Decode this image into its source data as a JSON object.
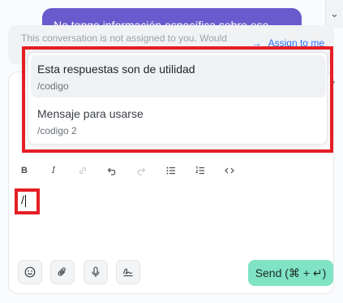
{
  "conversation": {
    "message_text": "No tengo información específica sobre ese",
    "notice_text": "This conversation is not assigned to you. Would",
    "assign_label": "Assign to me",
    "assign_arrow": "→"
  },
  "suggestions": [
    {
      "title": "Esta respuestas son de utilidad",
      "code": "/codigo",
      "active": true
    },
    {
      "title": "Mensaje para usarse",
      "code": "/codigo 2",
      "active": false
    }
  ],
  "toolbar": {
    "bold": "B",
    "italic": "I",
    "icons": [
      "bold-icon",
      "italic-icon",
      "link-icon",
      "undo-icon",
      "redo-icon",
      "bullet-list-icon",
      "numbered-list-icon",
      "code-icon"
    ]
  },
  "editor": {
    "value": "/"
  },
  "actions": {
    "send_label": "Send (⌘ + ↵)",
    "icons": [
      "emoji-icon",
      "attachment-icon",
      "microphone-icon",
      "signature-icon"
    ]
  },
  "colors": {
    "message_bubble": "#6a5acd",
    "assign_link": "#2c6ff2",
    "send_button": "#7fe3c4",
    "highlight": "#e51e25"
  }
}
